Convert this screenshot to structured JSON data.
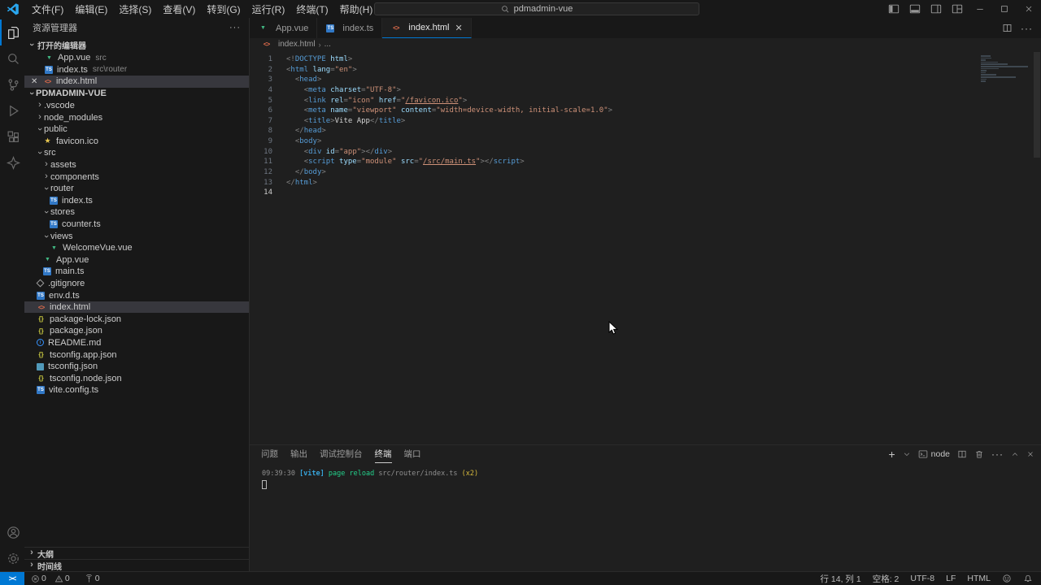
{
  "titlebar": {
    "menus": [
      "文件(F)",
      "编辑(E)",
      "选择(S)",
      "查看(V)",
      "转到(G)",
      "运行(R)",
      "终端(T)",
      "帮助(H)"
    ],
    "search": "pdmadmin-vue",
    "back": "←",
    "forward": "→"
  },
  "sidebar": {
    "title": "资源管理器",
    "more": "···",
    "open_editors": {
      "label": "打开的编辑器",
      "items": [
        {
          "icon": "vue",
          "name": "App.vue",
          "desc": "src",
          "active": false
        },
        {
          "icon": "ts",
          "name": "index.ts",
          "desc": "src\\router",
          "active": false
        },
        {
          "icon": "html",
          "name": "index.html",
          "desc": "",
          "active": true
        }
      ]
    },
    "tree": {
      "root": "PDMADMIN-VUE",
      "items": [
        {
          "indent": 1,
          "chev": ">",
          "name": ".vscode"
        },
        {
          "indent": 1,
          "chev": ">",
          "name": "node_modules"
        },
        {
          "indent": 1,
          "chev": "v",
          "name": "public"
        },
        {
          "indent": 2,
          "icon": "star",
          "name": "favicon.ico"
        },
        {
          "indent": 1,
          "chev": "v",
          "name": "src"
        },
        {
          "indent": 2,
          "chev": ">",
          "name": "assets"
        },
        {
          "indent": 2,
          "chev": ">",
          "name": "components"
        },
        {
          "indent": 2,
          "chev": "v",
          "name": "router"
        },
        {
          "indent": 3,
          "icon": "ts",
          "name": "index.ts"
        },
        {
          "indent": 2,
          "chev": "v",
          "name": "stores"
        },
        {
          "indent": 3,
          "icon": "ts",
          "name": "counter.ts"
        },
        {
          "indent": 2,
          "chev": "v",
          "name": "views"
        },
        {
          "indent": 3,
          "icon": "vue",
          "name": "WelcomeVue.vue"
        },
        {
          "indent": 2,
          "icon": "vue",
          "name": "App.vue"
        },
        {
          "indent": 2,
          "icon": "ts",
          "name": "main.ts"
        },
        {
          "indent": 1,
          "icon": "git",
          "name": ".gitignore"
        },
        {
          "indent": 1,
          "icon": "ts",
          "name": "env.d.ts"
        },
        {
          "indent": 1,
          "icon": "html",
          "name": "index.html",
          "selected": true
        },
        {
          "indent": 1,
          "icon": "json",
          "name": "package-lock.json"
        },
        {
          "indent": 1,
          "icon": "json",
          "name": "package.json"
        },
        {
          "indent": 1,
          "icon": "info",
          "name": "README.md"
        },
        {
          "indent": 1,
          "icon": "json",
          "name": "tsconfig.app.json"
        },
        {
          "indent": 1,
          "icon": "tsc",
          "name": "tsconfig.json"
        },
        {
          "indent": 1,
          "icon": "json",
          "name": "tsconfig.node.json"
        },
        {
          "indent": 1,
          "icon": "ts",
          "name": "vite.config.ts"
        }
      ]
    },
    "sections": [
      {
        "label": "大纲"
      },
      {
        "label": "时间线"
      }
    ]
  },
  "tabs": [
    {
      "icon": "vue",
      "label": "App.vue",
      "active": false
    },
    {
      "icon": "ts",
      "label": "index.ts",
      "active": false
    },
    {
      "icon": "html",
      "label": "index.html",
      "active": true
    }
  ],
  "breadcrumb": {
    "file": "index.html",
    "rest": "..."
  },
  "editor": {
    "lines": [
      {
        "n": 1,
        "tk": [
          [
            "<!",
            "pun"
          ],
          [
            "DOCTYPE",
            "tag"
          ],
          [
            " html",
            "attr"
          ],
          [
            ">",
            "pun"
          ]
        ]
      },
      {
        "n": 2,
        "tk": [
          [
            "<",
            "pun"
          ],
          [
            "html",
            "tag"
          ],
          [
            " ",
            "txt"
          ],
          [
            "lang",
            "attr"
          ],
          [
            "=",
            "pun"
          ],
          [
            "\"en\"",
            "str"
          ],
          [
            ">",
            "pun"
          ]
        ]
      },
      {
        "n": 3,
        "tk": [
          [
            "  ",
            "txt"
          ],
          [
            "<",
            "pun"
          ],
          [
            "head",
            "tag"
          ],
          [
            ">",
            "pun"
          ]
        ]
      },
      {
        "n": 4,
        "tk": [
          [
            "    ",
            "txt"
          ],
          [
            "<",
            "pun"
          ],
          [
            "meta",
            "tag"
          ],
          [
            " ",
            "txt"
          ],
          [
            "charset",
            "attr"
          ],
          [
            "=",
            "pun"
          ],
          [
            "\"UTF-8\"",
            "str"
          ],
          [
            ">",
            "pun"
          ]
        ]
      },
      {
        "n": 5,
        "tk": [
          [
            "    ",
            "txt"
          ],
          [
            "<",
            "pun"
          ],
          [
            "link",
            "tag"
          ],
          [
            " ",
            "txt"
          ],
          [
            "rel",
            "attr"
          ],
          [
            "=",
            "pun"
          ],
          [
            "\"icon\"",
            "str"
          ],
          [
            " ",
            "txt"
          ],
          [
            "href",
            "attr"
          ],
          [
            "=",
            "pun"
          ],
          [
            "\"",
            "str"
          ],
          [
            "/favicon.ico",
            "str lnk"
          ],
          [
            "\"",
            "str"
          ],
          [
            ">",
            "pun"
          ]
        ]
      },
      {
        "n": 6,
        "tk": [
          [
            "    ",
            "txt"
          ],
          [
            "<",
            "pun"
          ],
          [
            "meta",
            "tag"
          ],
          [
            " ",
            "txt"
          ],
          [
            "name",
            "attr"
          ],
          [
            "=",
            "pun"
          ],
          [
            "\"viewport\"",
            "str"
          ],
          [
            " ",
            "txt"
          ],
          [
            "content",
            "attr"
          ],
          [
            "=",
            "pun"
          ],
          [
            "\"width=device-width, initial-scale=1.0\"",
            "str"
          ],
          [
            ">",
            "pun"
          ]
        ]
      },
      {
        "n": 7,
        "tk": [
          [
            "    ",
            "txt"
          ],
          [
            "<",
            "pun"
          ],
          [
            "title",
            "tag"
          ],
          [
            ">",
            "pun"
          ],
          [
            "Vite App",
            "txt"
          ],
          [
            "</",
            "pun"
          ],
          [
            "title",
            "tag"
          ],
          [
            ">",
            "pun"
          ]
        ]
      },
      {
        "n": 8,
        "tk": [
          [
            "  ",
            "txt"
          ],
          [
            "</",
            "pun"
          ],
          [
            "head",
            "tag"
          ],
          [
            ">",
            "pun"
          ]
        ]
      },
      {
        "n": 9,
        "tk": [
          [
            "  ",
            "txt"
          ],
          [
            "<",
            "pun"
          ],
          [
            "body",
            "tag"
          ],
          [
            ">",
            "pun"
          ]
        ]
      },
      {
        "n": 10,
        "tk": [
          [
            "    ",
            "txt"
          ],
          [
            "<",
            "pun"
          ],
          [
            "div",
            "tag"
          ],
          [
            " ",
            "txt"
          ],
          [
            "id",
            "attr"
          ],
          [
            "=",
            "pun"
          ],
          [
            "\"app\"",
            "str"
          ],
          [
            ">",
            "pun"
          ],
          [
            "</",
            "pun"
          ],
          [
            "div",
            "tag"
          ],
          [
            ">",
            "pun"
          ]
        ]
      },
      {
        "n": 11,
        "tk": [
          [
            "    ",
            "txt"
          ],
          [
            "<",
            "pun"
          ],
          [
            "script",
            "tag"
          ],
          [
            " ",
            "txt"
          ],
          [
            "type",
            "attr"
          ],
          [
            "=",
            "pun"
          ],
          [
            "\"module\"",
            "str"
          ],
          [
            " ",
            "txt"
          ],
          [
            "src",
            "attr"
          ],
          [
            "=",
            "pun"
          ],
          [
            "\"",
            "str"
          ],
          [
            "/src/main.ts",
            "str lnk"
          ],
          [
            "\"",
            "str"
          ],
          [
            ">",
            "pun"
          ],
          [
            "</",
            "pun"
          ],
          [
            "script",
            "tag"
          ],
          [
            ">",
            "pun"
          ]
        ]
      },
      {
        "n": 12,
        "tk": [
          [
            "  ",
            "txt"
          ],
          [
            "</",
            "pun"
          ],
          [
            "body",
            "tag"
          ],
          [
            ">",
            "pun"
          ]
        ]
      },
      {
        "n": 13,
        "tk": [
          [
            "</",
            "pun"
          ],
          [
            "html",
            "tag"
          ],
          [
            ">",
            "pun"
          ]
        ]
      },
      {
        "n": 14,
        "tk": [],
        "cursor": true
      }
    ]
  },
  "panel": {
    "tabs": [
      {
        "label": "问题",
        "active": false
      },
      {
        "label": "输出",
        "active": false
      },
      {
        "label": "调试控制台",
        "active": false
      },
      {
        "label": "终端",
        "active": true
      },
      {
        "label": "端口",
        "active": false
      }
    ],
    "shell_label": "node",
    "terminal_line": [
      [
        "09:39:30 ",
        "td"
      ],
      [
        "[vite] ",
        "tc"
      ],
      [
        "page reload ",
        "tg"
      ],
      [
        "src/router/index.ts ",
        "td"
      ],
      [
        "(x2)",
        "ty"
      ]
    ]
  },
  "statusbar": {
    "remote": "><",
    "errors": "0",
    "warnings": "0",
    "ports": "0",
    "right": [
      "行 14, 列 1",
      "空格: 2",
      "UTF-8",
      "LF",
      "HTML"
    ]
  },
  "colors": {
    "accent": "#0078d4",
    "vue_green": "#41b883",
    "ts_blue": "#3178c6",
    "html_orange": "#e06c4c"
  }
}
